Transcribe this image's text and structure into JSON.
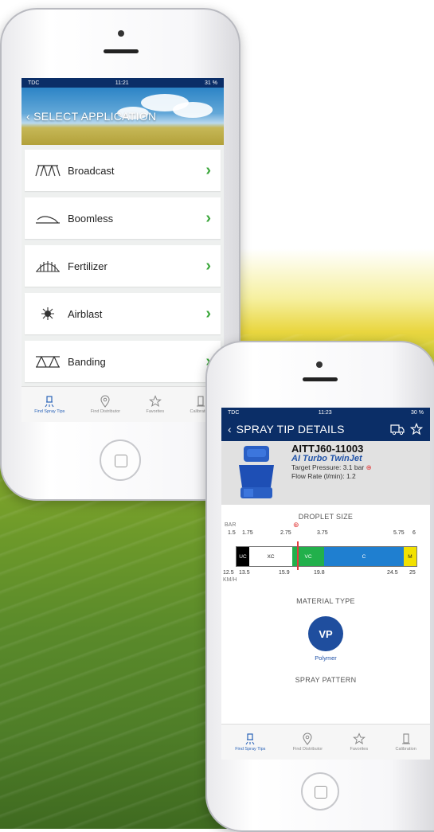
{
  "phone1": {
    "status": {
      "carrier": "TDC",
      "time": "11:21",
      "battery": "31 %"
    },
    "header_title": "SELECT APPLICATION",
    "applications": [
      {
        "label": "Broadcast",
        "icon": "broadcast-icon"
      },
      {
        "label": "Boomless",
        "icon": "boomless-icon"
      },
      {
        "label": "Fertilizer",
        "icon": "fertilizer-icon"
      },
      {
        "label": "Airblast",
        "icon": "airblast-icon"
      },
      {
        "label": "Banding",
        "icon": "banding-icon"
      }
    ],
    "tabs": [
      {
        "label": "Find Spray Tips",
        "icon": "spray-tip-icon"
      },
      {
        "label": "Find Distributor",
        "icon": "location-pin-icon"
      },
      {
        "label": "Favorites",
        "icon": "star-icon"
      },
      {
        "label": "Calibration",
        "icon": "calibration-icon"
      }
    ]
  },
  "phone2": {
    "status": {
      "carrier": "TDC",
      "time": "11:23",
      "battery": "30 %"
    },
    "nav_title": "SPRAY TIP DETAILS",
    "product": {
      "code": "AITTJ60-11003",
      "name": "AI Turbo TwinJet",
      "target_pressure": "Target Pressure: 3.1 bar",
      "flow_rate": "Flow Rate (l/min): 1.2"
    },
    "droplet": {
      "title": "DROPLET SIZE",
      "bar_unit": "BAR",
      "kmh_unit": "KM/H",
      "bar_ticks": [
        "1.5",
        "1.75",
        "2.75",
        "3.75",
        "5.75",
        "6"
      ],
      "kmh_ticks": [
        "12.5",
        "13.5",
        "15.9",
        "19.8",
        "24.5",
        "25"
      ],
      "segments": [
        "UC",
        "XC",
        "VC",
        "C",
        "M"
      ],
      "colors": {
        "UC": "#000000",
        "XC": "#ffffff",
        "VC": "#22b04b",
        "C": "#1f7fd0",
        "M": "#f2e100"
      }
    },
    "material": {
      "title": "MATERIAL TYPE",
      "code": "VP",
      "label": "Polymer"
    },
    "pattern_title": "SPRAY PATTERN",
    "tabs": [
      {
        "label": "Find Spray Tips"
      },
      {
        "label": "Find Distributor"
      },
      {
        "label": "Favorites"
      },
      {
        "label": "Calibration"
      }
    ]
  },
  "accent": "#0b2e67"
}
